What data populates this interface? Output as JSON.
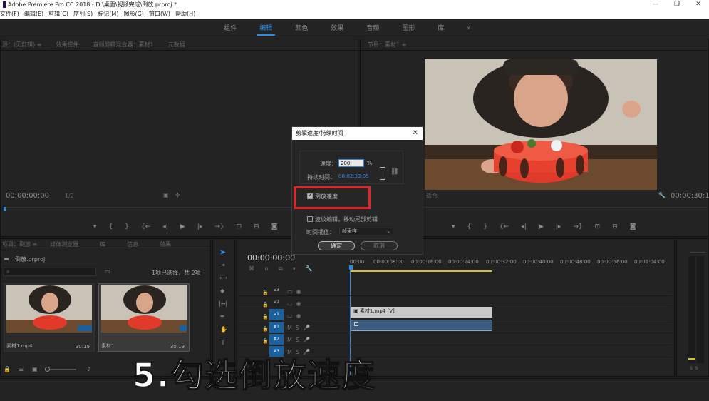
{
  "titlebar": {
    "title": "Adobe Premiere Pro CC 2018 - D:\\桌面\\视频完成\\倒放.prproj *",
    "minimize": "—",
    "maximize": "❐",
    "close": "✕"
  },
  "menu": [
    "文件(F)",
    "编辑(E)",
    "剪辑(C)",
    "序列(S)",
    "标记(M)",
    "图形(G)",
    "窗口(W)",
    "帮助(H)"
  ],
  "workspaces": [
    {
      "label": "组件"
    },
    {
      "label": "编辑"
    },
    {
      "label": "颜色"
    },
    {
      "label": "效果"
    },
    {
      "label": "音频"
    },
    {
      "label": "图形"
    },
    {
      "label": "库"
    },
    {
      "label": "»"
    }
  ],
  "source_panel": {
    "tabs": [
      "源：(无剪辑) ≡",
      "效果控件",
      "音频剪辑混合器：素材1",
      "元数据"
    ],
    "timecode": "00;00;00;00",
    "fit": "1/2"
  },
  "program_panel": {
    "tab": "节目：素材1 ≡",
    "timecode_right": "00:00:30:19",
    "fit_label": "适合"
  },
  "project_panel": {
    "tabs": [
      "项目：倒放 ≡",
      "媒体浏览器",
      "库",
      "信息",
      "效果"
    ],
    "project_name": "倒放.prproj",
    "selection_text": "1项已选择，共 2项",
    "items": [
      {
        "name": "素材1.mp4",
        "duration": "30:19"
      },
      {
        "name": "素材1",
        "duration": "30:19"
      }
    ]
  },
  "timeline": {
    "timecode": "00:00:00:00",
    "ruler": [
      "00:00",
      "00:00:08:00",
      "00:00:16:00",
      "00:00:24:00",
      "00:00:32:00",
      "00:00:40:00",
      "00:00:48:00",
      "00:00:56:00",
      "00:01:04:00"
    ],
    "tracks": [
      "V3",
      "V2",
      "V1",
      "A1",
      "A2",
      "A3"
    ],
    "clip_label": "素材1.mp4 [V]"
  },
  "dialog": {
    "title": "剪辑速度/持续时间",
    "speed_label": "速度：",
    "speed_value": "200",
    "percent": "%",
    "duration_label": "持续时间：",
    "duration_value": "00:02:33:05",
    "reverse_label": "倒放速度",
    "reverse_checked": true,
    "ripple_label": "波纹编辑，移动尾部剪辑",
    "interp_label": "时间插值：",
    "interp_value": "帧采样",
    "ok": "确定",
    "cancel": "取消"
  },
  "caption": "5.勾选倒放速度",
  "colors": {
    "accent": "#2d8ceb",
    "highlight_box": "#e0242a",
    "panel_bg": "#232323"
  }
}
